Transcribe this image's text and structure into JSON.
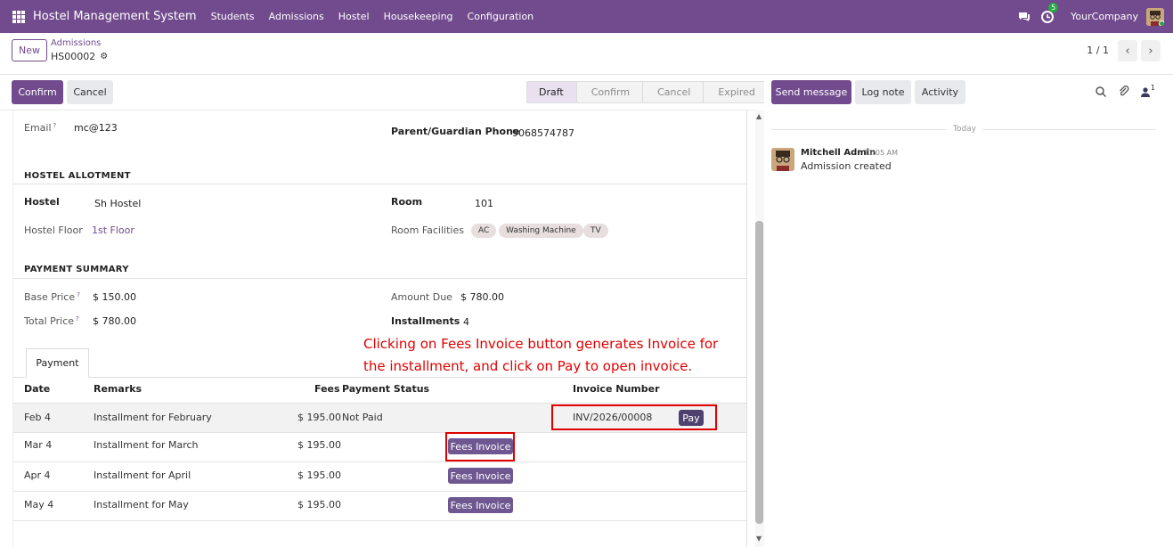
{
  "topbar": {
    "app_title": "Hostel Management System",
    "menu": [
      "Students",
      "Admissions",
      "Hostel",
      "Housekeeping",
      "Configuration"
    ],
    "activity_badge": "5",
    "company": "YourCompany",
    "bg_color": "#714b8e"
  },
  "control": {
    "new_label": "New",
    "breadcrumb_parent": "Admissions",
    "record_name": "HS00002",
    "pager": "1 / 1"
  },
  "actions": {
    "confirm_label": "Confirm",
    "cancel_label": "Cancel",
    "stages": [
      "Draft",
      "Confirm",
      "Cancel",
      "Expired"
    ],
    "active_stage": "Draft"
  },
  "form": {
    "email_label": "Email",
    "email_value": "mc@123",
    "guardian_label": "Parent/Guardian Phone",
    "guardian_value": "9068574787",
    "allotment_title": "HOSTEL ALLOTMENT",
    "hostel_label": "Hostel",
    "hostel_value": "Sh Hostel",
    "room_label": "Room",
    "room_value": "101",
    "floor_label": "Hostel Floor",
    "floor_value": "1st Floor",
    "facilities_label": "Room Facilities",
    "facilities": [
      "AC",
      "Washing Machine",
      "TV"
    ],
    "payment_title": "PAYMENT SUMMARY",
    "base_label": "Base Price",
    "base_value": "$ 150.00",
    "amount_due_label": "Amount Due",
    "amount_due_value": "$ 780.00",
    "total_label": "Total Price",
    "total_value": "$ 780.00",
    "installments_label": "Installments",
    "installments_value": "4"
  },
  "payment_tab": {
    "tab_label": "Payment",
    "columns": [
      "Date",
      "Remarks",
      "Fees",
      "Payment Status",
      "Invoice Number"
    ],
    "rows": [
      {
        "date": "Feb 4",
        "remarks": "Installment for February",
        "fees": "$ 195.00",
        "status": "Not Paid",
        "invoice": "INV/2026/00008",
        "action": "Pay"
      },
      {
        "date": "Mar 4",
        "remarks": "Installment for March",
        "fees": "$ 195.00",
        "status": "",
        "invoice": "",
        "action": "Fees Invoice"
      },
      {
        "date": "Apr 4",
        "remarks": "Installment for April",
        "fees": "$ 195.00",
        "status": "",
        "invoice": "",
        "action": "Fees Invoice"
      },
      {
        "date": "May 4",
        "remarks": "Installment for May",
        "fees": "$ 195.00",
        "status": "",
        "invoice": "",
        "action": "Fees Invoice"
      }
    ],
    "annotation": "Clicking on Fees Invoice button generates Invoice for the installment, and click on Pay to open invoice."
  },
  "chatter": {
    "send_message": "Send message",
    "log_note": "Log note",
    "activity": "Activity",
    "followers_count": "1",
    "today_label": "Today",
    "message": {
      "author": "Mitchell Admin",
      "time": "11:05 AM",
      "body": "Admission created"
    }
  }
}
